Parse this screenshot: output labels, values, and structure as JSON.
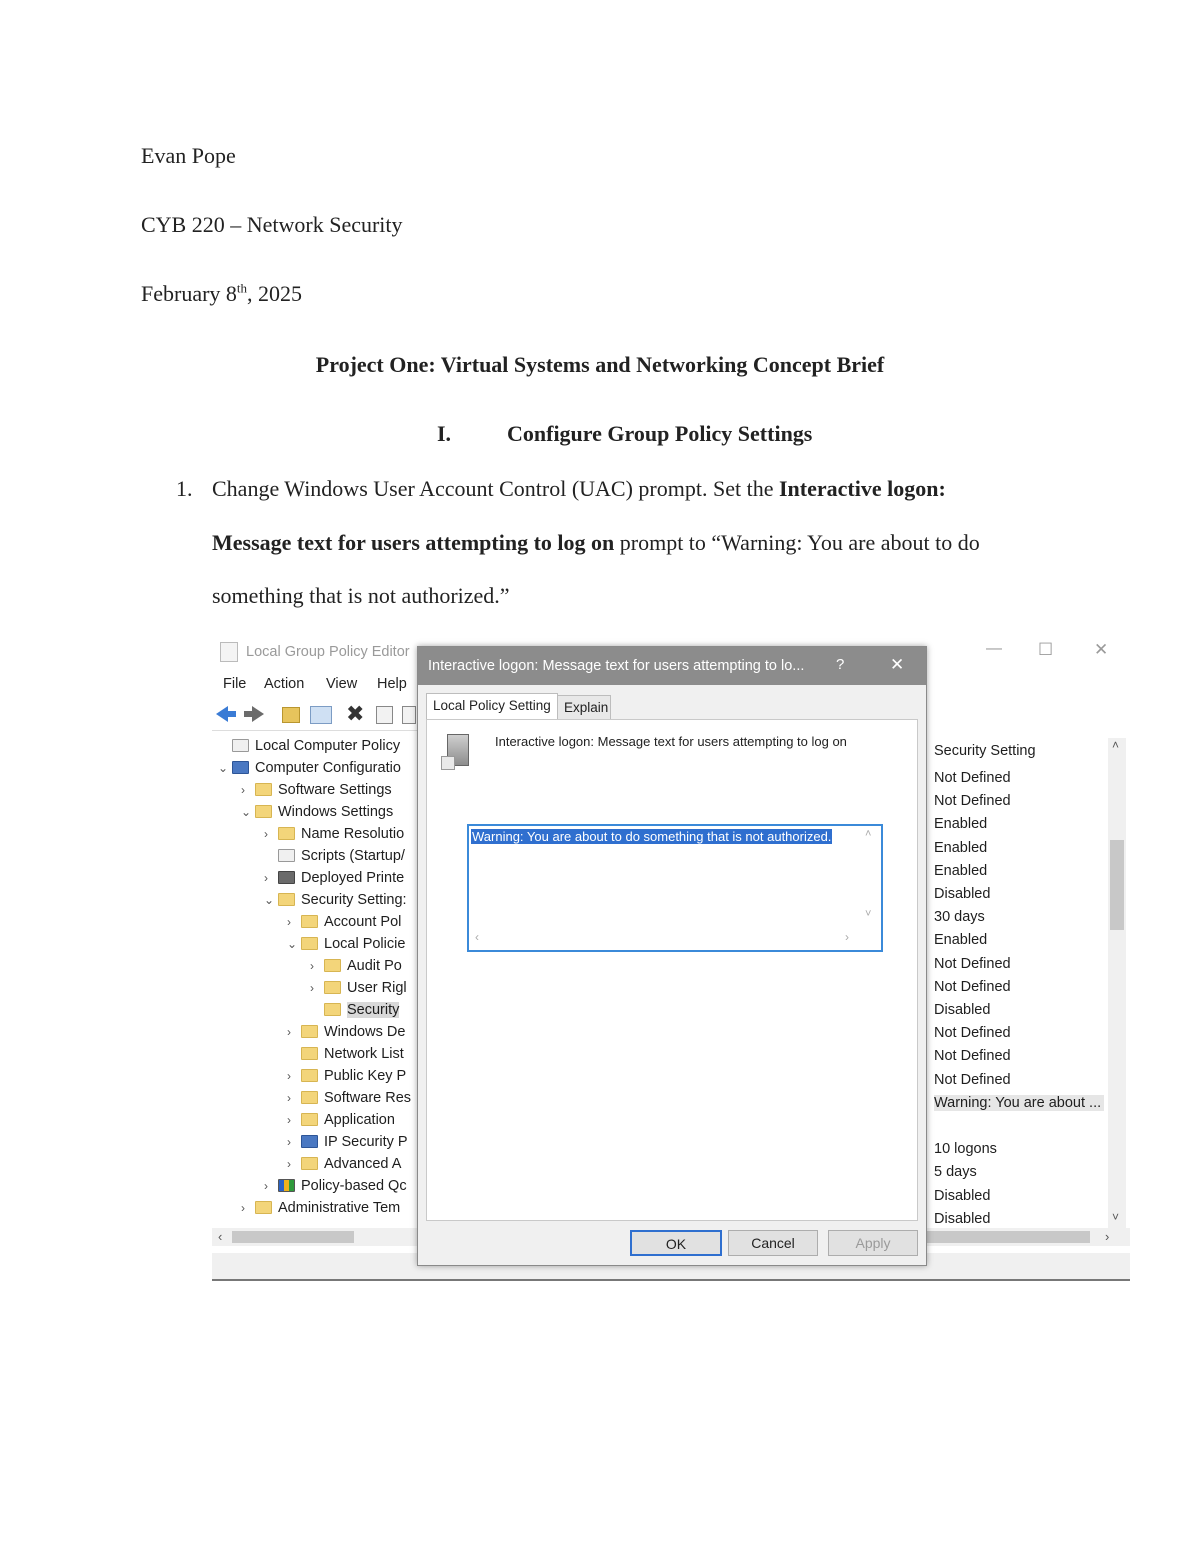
{
  "header": {
    "author": "Evan Pope",
    "course": "CYB 220 – Network Security",
    "date_prefix": "February 8",
    "date_sup": "th",
    "date_suffix": ", 2025"
  },
  "title": "Project One: Virtual Systems and Networking Concept Brief",
  "section": {
    "numeral": "I.",
    "heading": "Configure Group Policy Settings"
  },
  "step1": {
    "number": "1.",
    "line1_plain": "Change Windows User Account Control (UAC) prompt. Set the ",
    "line1_bold": "Interactive logon:",
    "line2_bold": "Message text for users attempting to log on",
    "line2_plain": " prompt to “Warning: You are about to do",
    "line3": "something that is not authorized.”"
  },
  "screenshot": {
    "gpedit": {
      "window_title": "Local Group Policy Editor",
      "menu": [
        "File",
        "Action",
        "View",
        "Help"
      ],
      "window_controls": {
        "minimize": "—",
        "maximize": "☐",
        "close": "✕"
      },
      "tree": [
        {
          "label": "Local Computer Policy",
          "level": 0,
          "chev": "",
          "icon": "policy-icon"
        },
        {
          "label": "Computer Configuratio",
          "level": 0,
          "chev": "v",
          "icon": "computer-icon"
        },
        {
          "label": "Software Settings",
          "level": 1,
          "chev": ">",
          "icon": "folder-icon"
        },
        {
          "label": "Windows Settings",
          "level": 1,
          "chev": "v",
          "icon": "folder-icon"
        },
        {
          "label": "Name Resolutio",
          "level": 2,
          "chev": ">",
          "icon": "folder-icon"
        },
        {
          "label": "Scripts (Startup/",
          "level": 2,
          "chev": "",
          "icon": "script-icon"
        },
        {
          "label": "Deployed Printe",
          "level": 2,
          "chev": ">",
          "icon": "printer-icon"
        },
        {
          "label": "Security Setting:",
          "level": 2,
          "chev": "v",
          "icon": "security-icon"
        },
        {
          "label": "Account Pol",
          "level": 3,
          "chev": ">",
          "icon": "lock-folder-icon"
        },
        {
          "label": "Local Policie",
          "level": 3,
          "chev": "v",
          "icon": "lock-folder-icon"
        },
        {
          "label": "Audit Po",
          "level": 4,
          "chev": ">",
          "icon": "lock-folder-icon"
        },
        {
          "label": "User Rigl",
          "level": 4,
          "chev": ">",
          "icon": "lock-folder-icon"
        },
        {
          "label": "Security",
          "level": 4,
          "chev": "",
          "icon": "lock-folder-icon"
        },
        {
          "label": "Windows De",
          "level": 3,
          "chev": ">",
          "icon": "folder-icon"
        },
        {
          "label": "Network List",
          "level": 3,
          "chev": "",
          "icon": "folder-icon"
        },
        {
          "label": "Public Key P",
          "level": 3,
          "chev": ">",
          "icon": "folder-icon"
        },
        {
          "label": "Software Res",
          "level": 3,
          "chev": ">",
          "icon": "folder-icon"
        },
        {
          "label": "Application",
          "level": 3,
          "chev": ">",
          "icon": "folder-icon"
        },
        {
          "label": "IP Security P",
          "level": 3,
          "chev": ">",
          "icon": "shield-icon"
        },
        {
          "label": "Advanced A",
          "level": 3,
          "chev": ">",
          "icon": "folder-icon"
        },
        {
          "label": "Policy-based Qc",
          "level": 2,
          "chev": ">",
          "icon": "chart-icon"
        },
        {
          "label": "Administrative Tem",
          "level": 1,
          "chev": ">",
          "icon": "folder-icon"
        }
      ],
      "settings_header": "Security Setting",
      "settings": [
        "Not Defined",
        "Not Defined",
        "Enabled",
        "Enabled",
        "Enabled",
        "Disabled",
        "30 days",
        "Enabled",
        "Not Defined",
        "Not Defined",
        "Disabled",
        "Not Defined",
        "Not Defined",
        "Not Defined",
        "Warning: You are about ...",
        "",
        "10 logons",
        "5 days",
        "Disabled",
        "Disabled"
      ]
    },
    "dialog": {
      "title": "Interactive logon: Message text for users attempting to lo...",
      "help": "?",
      "close": "✕",
      "tabs": [
        "Local Policy Setting",
        "Explain"
      ],
      "policy_name": "Interactive logon: Message text for users attempting to log on",
      "text_value": "Warning: You are about to do something that is not authorized.",
      "buttons": {
        "ok": "OK",
        "cancel": "Cancel",
        "apply": "Apply"
      }
    }
  }
}
